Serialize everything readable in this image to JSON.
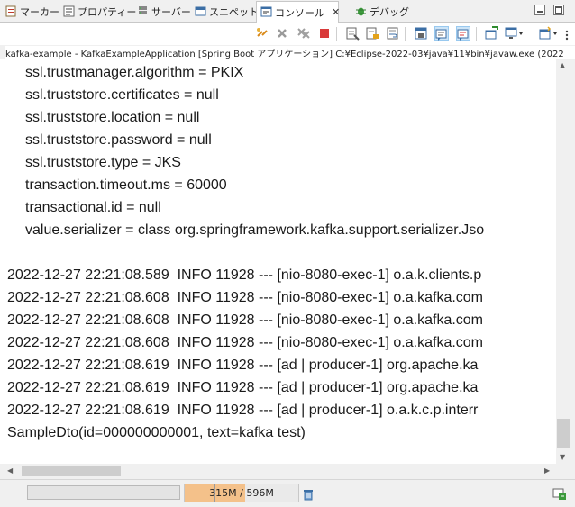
{
  "tabs": [
    {
      "label": "マーカー",
      "icon": "markers-icon"
    },
    {
      "label": "プロパティー",
      "icon": "properties-icon"
    },
    {
      "label": "サーバー",
      "icon": "servers-icon"
    },
    {
      "label": "スニペット",
      "icon": "snippets-icon"
    },
    {
      "label": "コンソール",
      "icon": "console-icon",
      "active": true,
      "close": "✕"
    },
    {
      "label": "デバッグ",
      "icon": "debug-icon"
    }
  ],
  "path_line": "kafka-example - KafkaExampleApplication [Spring Boot アプリケーション] C:¥Eclipse-2022-03¥java¥11¥bin¥javaw.exe  (2022",
  "console_lines": [
    {
      "text": "ssl.trustmanager.algorithm = PKIX",
      "indent": true
    },
    {
      "text": "ssl.truststore.certificates = null",
      "indent": true
    },
    {
      "text": "ssl.truststore.location = null",
      "indent": true
    },
    {
      "text": "ssl.truststore.password = null",
      "indent": true
    },
    {
      "text": "ssl.truststore.type = JKS",
      "indent": true
    },
    {
      "text": "transaction.timeout.ms = 60000",
      "indent": true
    },
    {
      "text": "transactional.id = null",
      "indent": true
    },
    {
      "text": "value.serializer = class org.springframework.kafka.support.serializer.Jso",
      "indent": true
    },
    {
      "text": "",
      "indent": false
    },
    {
      "text": "2022-12-27 22:21:08.589  INFO 11928 --- [nio-8080-exec-1] o.a.k.clients.p",
      "indent": false
    },
    {
      "text": "2022-12-27 22:21:08.608  INFO 11928 --- [nio-8080-exec-1] o.a.kafka.com",
      "indent": false
    },
    {
      "text": "2022-12-27 22:21:08.608  INFO 11928 --- [nio-8080-exec-1] o.a.kafka.com",
      "indent": false
    },
    {
      "text": "2022-12-27 22:21:08.608  INFO 11928 --- [nio-8080-exec-1] o.a.kafka.com",
      "indent": false
    },
    {
      "text": "2022-12-27 22:21:08.619  INFO 11928 --- [ad | producer-1] org.apache.ka",
      "indent": false
    },
    {
      "text": "2022-12-27 22:21:08.619  INFO 11928 --- [ad | producer-1] org.apache.ka",
      "indent": false
    },
    {
      "text": "2022-12-27 22:21:08.619  INFO 11928 --- [ad | producer-1] o.a.k.c.p.interr",
      "indent": false
    },
    {
      "text": "SampleDto(id=000000000001, text=kafka test)",
      "indent": false
    }
  ],
  "heap": {
    "label": "315M / 596M",
    "used_fraction": 0.528
  },
  "colors": {
    "accent": "#cce4f7",
    "heap_used": "#f4c18a",
    "stop": "#d93a3a"
  }
}
